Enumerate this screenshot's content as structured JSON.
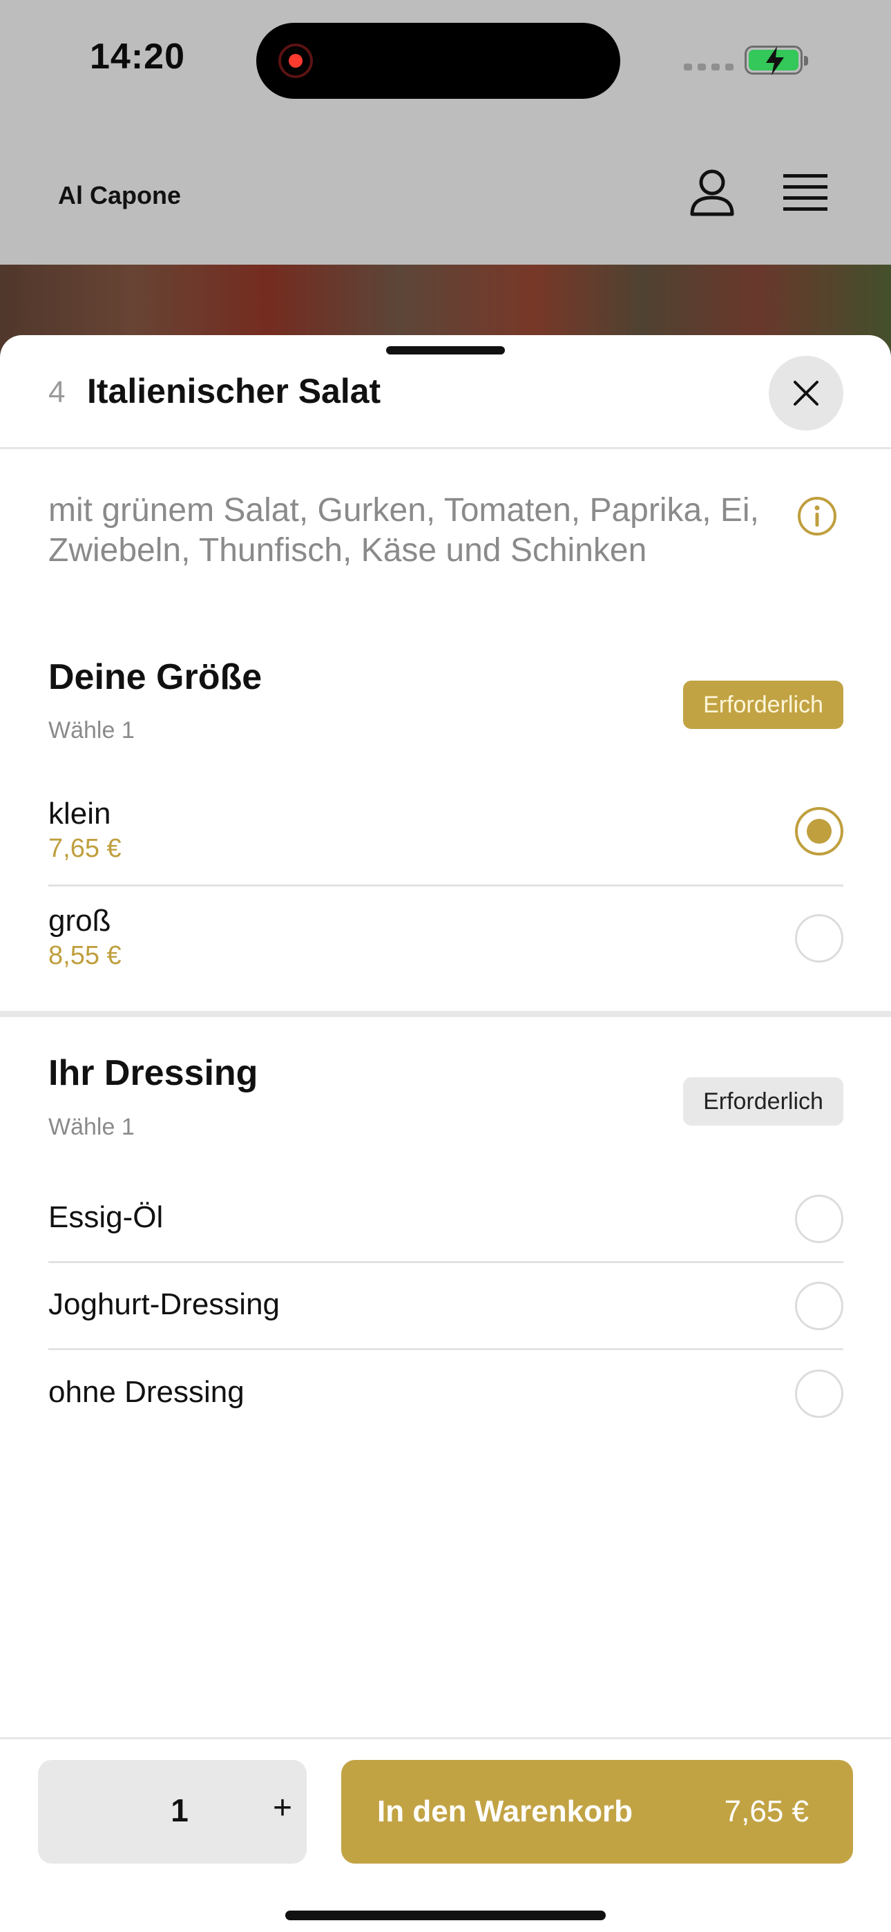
{
  "status_bar": {
    "time": "14:20"
  },
  "app": {
    "title": "Al Capone"
  },
  "item": {
    "number": "4",
    "title": "Italienischer Salat",
    "description": "mit grünem Salat, Gurken, Tomaten, Paprika, Ei, Zwiebeln, Thunfisch, Käse und Schinken"
  },
  "size_section": {
    "title": "Deine Größe",
    "subtitle": "Wähle 1",
    "badge": "Erforderlich",
    "options": [
      {
        "label": "klein",
        "price": "7,65 €",
        "selected": true
      },
      {
        "label": "groß",
        "price": "8,55 €",
        "selected": false
      }
    ]
  },
  "dressing_section": {
    "title": "Ihr Dressing",
    "subtitle": "Wähle 1",
    "badge": "Erforderlich",
    "options": [
      {
        "label": "Essig-Öl",
        "selected": false
      },
      {
        "label": "Joghurt-Dressing",
        "selected": false
      },
      {
        "label": "ohne Dressing",
        "selected": false
      }
    ]
  },
  "bottom": {
    "quantity": "1",
    "plus": "+",
    "cart_label": "In den Warenkorb",
    "cart_price": "7,65 €"
  },
  "colors": {
    "accent": "#c2a344",
    "badge_gray": "#e8e8e8",
    "overlay": "#bdbdbd"
  }
}
